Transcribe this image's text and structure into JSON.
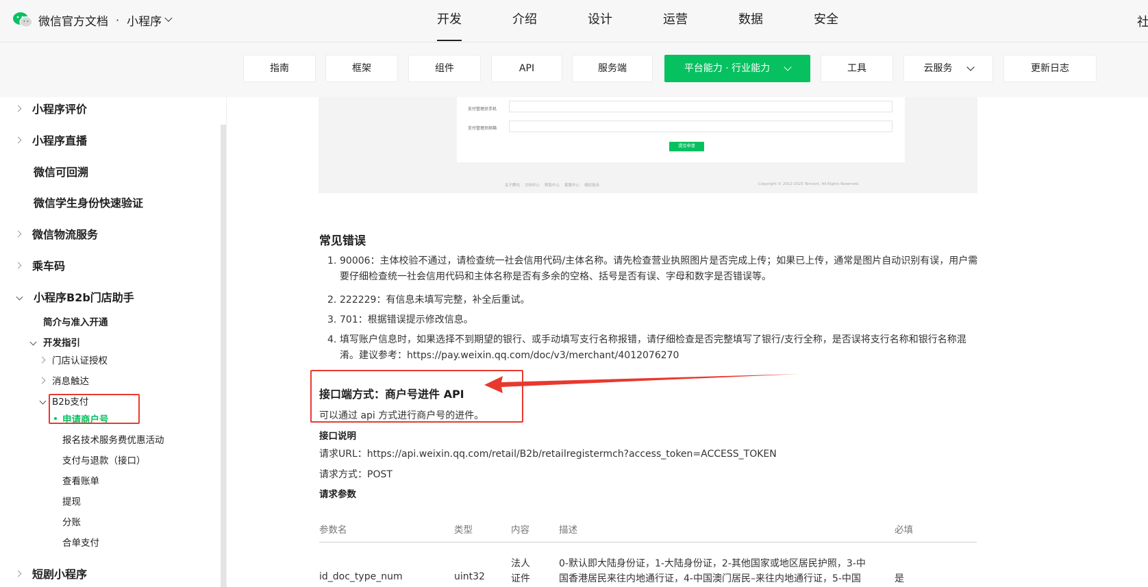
{
  "header": {
    "brand_name": "微信官方文档",
    "separator": "·",
    "product": "小程序",
    "nav": [
      "开发",
      "介绍",
      "设计",
      "运营",
      "数据",
      "安全"
    ],
    "nav_active": "开发",
    "nav_edge": "社"
  },
  "subnav": {
    "tabs": [
      "指南",
      "框架",
      "组件",
      "API",
      "服务端",
      "平台能力 · 行业能力",
      "工具",
      "云服务",
      "更新日志"
    ],
    "active": "平台能力 · 行业能力"
  },
  "sidebar": {
    "top_items": [
      "小程序评价",
      "小程序直播",
      "微信可回溯",
      "微信学生身份快速验证",
      "微信物流服务",
      "乘车码",
      "小程序B2b门店助手"
    ],
    "b2b_children": {
      "intro": "简介与准入开通",
      "dev_guide": "开发指引",
      "store_auth": "门店认证授权",
      "message": "消息触达",
      "b2b_pay": "B2b支付",
      "apply_merchant": "申请商户号",
      "pay_children": [
        "报名技术服务费优惠活动",
        "支付与退款（接口）",
        "查看账单",
        "提现",
        "分账",
        "合单支付"
      ]
    },
    "bottom_item": "短剧小程序"
  },
  "embedded_screenshot": {
    "label_phone": "支付管理员手机",
    "label_email": "支付管理员邮箱",
    "submit_button": "提交申请",
    "footer_links": [
      "关于腾讯",
      "文档中心",
      "帮助中心",
      "客服中心",
      "侵权投诉"
    ],
    "copyright": "Copyright © 2012-2025 Tencent. All Rights Reserved."
  },
  "content": {
    "errors_title": "常见错误",
    "errors": [
      {
        "num": "1.",
        "text": "90006：主体校验不通过，请检查统一社会信用代码/主体名称。请先检查营业执照图片是否完成上传；如果已上传，通常是图片自动识别有误，用户需要仔细检查统一社会信用代码和主体名称是否有多余的空格、括号是否有误、字母和数字是否错误等。"
      },
      {
        "num": "2.",
        "text": "222229：有信息未填写完整，补全后重试。"
      },
      {
        "num": "3.",
        "text": "701：根据错误提示修改信息。"
      },
      {
        "num": "4.",
        "text": "填写账户信息时，如果选择不到期望的银行、或手动填写支行名称报错，请仔细检查是否完整填写了银行/支行全称，是否误将支行名称和银行名称混淆。建议参考：https://pay.weixin.qq.com/doc/v3/merchant/4012076270"
      }
    ],
    "api_title": "接口端方式：商户号进件 API",
    "api_desc": "可以通过 api 方式进行商户号的进件。",
    "api_explain_title": "接口说明",
    "request_url": "请求URL：https://api.weixin.qq.com/retail/B2b/retailregistermch?access_token=ACCESS_TOKEN",
    "request_method": "请求方式：POST",
    "params_title": "请求参数",
    "table": {
      "headers": [
        "参数名",
        "类型",
        "内容",
        "描述",
        "必填"
      ],
      "row1": {
        "name": "id_doc_type_num",
        "type": "uint32",
        "content": "法人证件",
        "desc": "0-默认即大陆身份证，1-大陆身份证，2-其他国家或地区居民护照，3-中国香港居民来往内地通行证，4-中国澳门居民–来往内地通行证，5-中国",
        "required": "是"
      }
    }
  },
  "colors": {
    "accent": "#07c160",
    "annotation": "#e8392f"
  }
}
